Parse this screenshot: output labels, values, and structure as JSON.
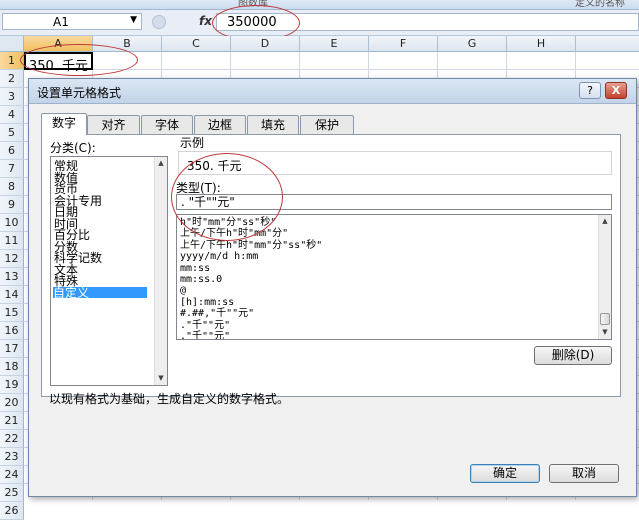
{
  "ribbon": {
    "left_text": "图数库",
    "right_text": "定义的名称"
  },
  "formula_bar": {
    "name_box": "A1",
    "fx": "fx",
    "formula_value": "350000"
  },
  "columns": [
    "A",
    "B",
    "C",
    "D",
    "E",
    "F",
    "G",
    "H"
  ],
  "rows": [
    "1",
    "2",
    "3",
    "4",
    "5",
    "6",
    "7",
    "8",
    "9",
    "10",
    "11",
    "12",
    "13",
    "14",
    "15",
    "16",
    "17",
    "18",
    "19",
    "20",
    "21",
    "22",
    "23",
    "24",
    "25",
    "26"
  ],
  "cell_a1": {
    "display": "350. 千元"
  },
  "dialog": {
    "title": "设置单元格格式",
    "help": "?",
    "close": "X",
    "tabs": [
      "数字",
      "对齐",
      "字体",
      "边框",
      "填充",
      "保护"
    ],
    "category_label": "分类(C):",
    "categories": [
      "常规",
      "数值",
      "货币",
      "会计专用",
      "日期",
      "时间",
      "百分比",
      "分数",
      "科学记数",
      "文本",
      "特殊",
      "自定义"
    ],
    "selected_category_index": 11,
    "sample_label": "示例",
    "sample_value": "350. 千元",
    "type_label": "类型(T):",
    "type_value": ". \"千\"\"元\"",
    "formats": [
      "h\"时\"mm\"分\"ss\"秒\"",
      "上午/下午h\"时\"mm\"分\"",
      "上午/下午h\"时\"mm\"分\"ss\"秒\"",
      "yyyy/m/d h:mm",
      "mm:ss",
      "mm:ss.0",
      "@",
      "[h]:mm:ss",
      "#.##,\"千\"\"元\"",
      ".\"千\"\"元\"",
      ".\"千\"\"元\""
    ],
    "delete_button": "删除(D)",
    "description": "以现有格式为基础，生成自定义的数字格式。",
    "ok_button": "确定",
    "cancel_button": "取消"
  },
  "colors": {
    "accent_circle": "#c0383a",
    "selection": "#3399ff"
  }
}
